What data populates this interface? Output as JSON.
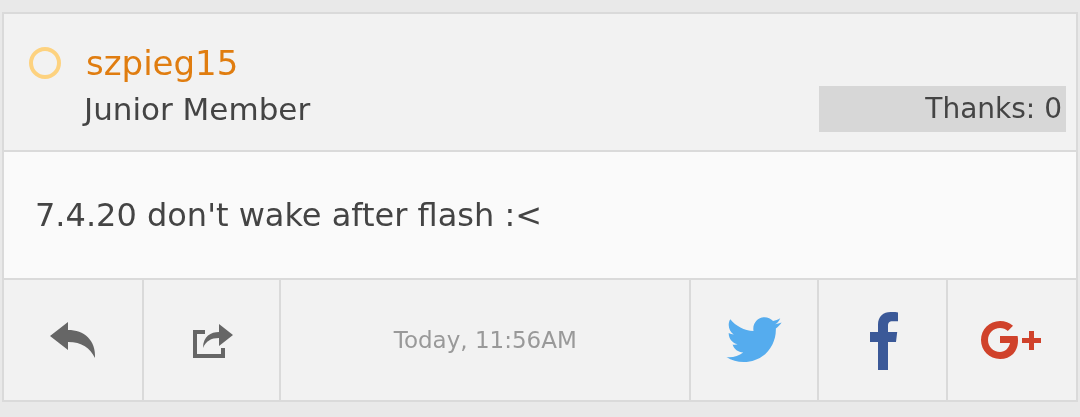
{
  "post": {
    "author": {
      "name": "szpieg15",
      "rank": "Junior Member"
    },
    "thanks": "Thanks: 0",
    "body": "7.4.20 don't wake after flash :<"
  },
  "footer": {
    "actions": [
      {
        "kind": "reply"
      },
      {
        "kind": "share"
      }
    ],
    "date": "Today, 11:56AM",
    "social": [
      {
        "kind": "twitter"
      },
      {
        "kind": "facebook"
      },
      {
        "kind": "googleplus"
      }
    ]
  }
}
